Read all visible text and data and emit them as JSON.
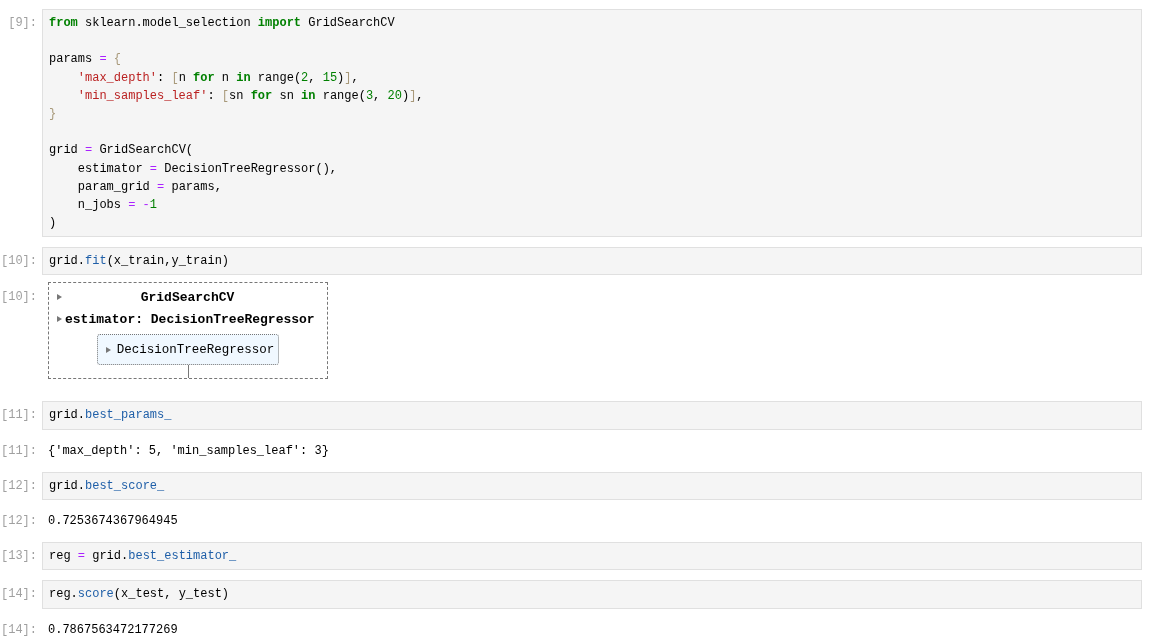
{
  "cells": [
    {
      "kind": "code",
      "prompt": "[9]:",
      "blocks": [
        [
          [
            {
              "text": "from",
              "kind": "kw"
            },
            {
              "text": " sklearn.model_selection ",
              "kind": "plain"
            },
            {
              "text": "import",
              "kind": "kw"
            },
            {
              "text": " GridSearchCV",
              "kind": "plain"
            }
          ]
        ],
        [
          [
            {
              "text": "params ",
              "kind": "plain"
            },
            {
              "text": "=",
              "kind": "op"
            },
            {
              "text": " {",
              "kind": "brace"
            }
          ],
          [
            {
              "text": "    'max_depth'",
              "kind": "str"
            },
            {
              "text": ": ",
              "kind": "plain"
            },
            {
              "text": "[",
              "kind": "brace"
            },
            {
              "text": "n ",
              "kind": "plain"
            },
            {
              "text": "for",
              "kind": "kw"
            },
            {
              "text": " n ",
              "kind": "plain"
            },
            {
              "text": "in",
              "kind": "kw"
            },
            {
              "text": " range(",
              "kind": "plain"
            },
            {
              "text": "2",
              "kind": "num"
            },
            {
              "text": ", ",
              "kind": "plain"
            },
            {
              "text": "15",
              "kind": "num"
            },
            {
              "text": ")",
              "kind": "plain"
            },
            {
              "text": "]",
              "kind": "brace"
            },
            {
              "text": ",",
              "kind": "plain"
            }
          ],
          [
            {
              "text": "    'min_samples_leaf'",
              "kind": "str"
            },
            {
              "text": ": ",
              "kind": "plain"
            },
            {
              "text": "[",
              "kind": "brace"
            },
            {
              "text": "sn ",
              "kind": "plain"
            },
            {
              "text": "for",
              "kind": "kw"
            },
            {
              "text": " sn ",
              "kind": "plain"
            },
            {
              "text": "in",
              "kind": "kw"
            },
            {
              "text": " range(",
              "kind": "plain"
            },
            {
              "text": "3",
              "kind": "num"
            },
            {
              "text": ", ",
              "kind": "plain"
            },
            {
              "text": "20",
              "kind": "num"
            },
            {
              "text": ")",
              "kind": "plain"
            },
            {
              "text": "]",
              "kind": "brace"
            },
            {
              "text": ",",
              "kind": "plain"
            }
          ],
          [
            {
              "text": "}",
              "kind": "brace"
            }
          ]
        ],
        [
          [
            {
              "text": "grid ",
              "kind": "plain"
            },
            {
              "text": "=",
              "kind": "op"
            },
            {
              "text": " GridSearchCV(",
              "kind": "plain"
            }
          ],
          [
            {
              "text": "    estimator ",
              "kind": "plain"
            },
            {
              "text": "=",
              "kind": "op"
            },
            {
              "text": " DecisionTreeRegressor(),",
              "kind": "plain"
            }
          ],
          [
            {
              "text": "    param_grid ",
              "kind": "plain"
            },
            {
              "text": "=",
              "kind": "op"
            },
            {
              "text": " params,",
              "kind": "plain"
            }
          ],
          [
            {
              "text": "    n_jobs ",
              "kind": "plain"
            },
            {
              "text": "=",
              "kind": "op"
            },
            {
              "text": " -",
              "kind": "op"
            },
            {
              "text": "1",
              "kind": "num"
            }
          ],
          [
            {
              "text": ")",
              "kind": "plain"
            }
          ]
        ]
      ]
    },
    {
      "kind": "code",
      "prompt": "[10]:",
      "blocks": [
        [
          [
            {
              "text": "grid.",
              "kind": "plain"
            },
            {
              "text": "fit",
              "kind": "attr"
            },
            {
              "text": "(x_train,y_train)",
              "kind": "plain"
            }
          ]
        ]
      ]
    },
    {
      "kind": "estimator",
      "prompt": "[10]:",
      "title": "GridSearchCV",
      "items": [
        {
          "label": "estimator: DecisionTreeRegressor",
          "children": [
            {
              "label": "DecisionTreeRegressor"
            }
          ]
        }
      ]
    },
    {
      "kind": "code",
      "prompt": "[11]:",
      "blocks": [
        [
          [
            {
              "text": "grid.",
              "kind": "plain"
            },
            {
              "text": "best_params_",
              "kind": "attr"
            }
          ]
        ]
      ]
    },
    {
      "kind": "text",
      "prompt": "[11]:",
      "text": "{'max_depth': 5, 'min_samples_leaf': 3}"
    },
    {
      "kind": "code",
      "prompt": "[12]:",
      "blocks": [
        [
          [
            {
              "text": "grid.",
              "kind": "plain"
            },
            {
              "text": "best_score_",
              "kind": "attr"
            }
          ]
        ]
      ]
    },
    {
      "kind": "text",
      "prompt": "[12]:",
      "text": "0.7253674367964945"
    },
    {
      "kind": "code",
      "prompt": "[13]:",
      "blocks": [
        [
          [
            {
              "text": "reg ",
              "kind": "plain"
            },
            {
              "text": "=",
              "kind": "op"
            },
            {
              "text": " grid.",
              "kind": "plain"
            },
            {
              "text": "best_estimator_",
              "kind": "attr"
            }
          ]
        ]
      ]
    },
    {
      "kind": "code",
      "prompt": "[14]:",
      "blocks": [
        [
          [
            {
              "text": "reg.",
              "kind": "plain"
            },
            {
              "text": "score",
              "kind": "attr"
            },
            {
              "text": "(x_test, y_test)",
              "kind": "plain"
            }
          ]
        ]
      ]
    },
    {
      "kind": "text",
      "prompt": "[14]:",
      "text": "0.7867563472177269"
    }
  ]
}
